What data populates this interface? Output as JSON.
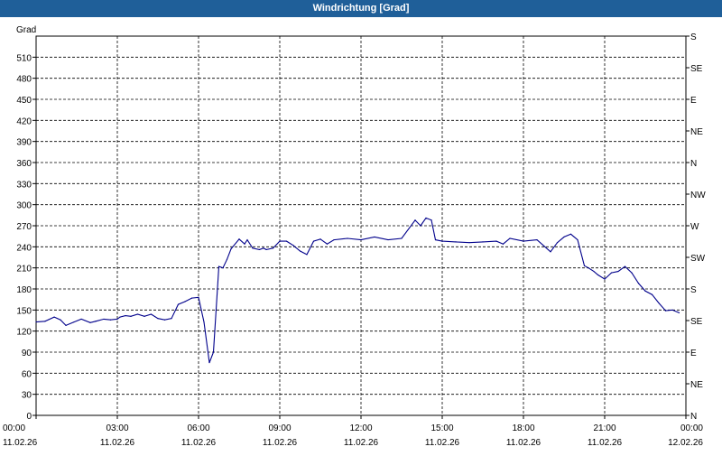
{
  "window": {
    "title": "Windrichtung [Grad]"
  },
  "chart_data": {
    "type": "line",
    "title": "Windrichtung [Grad]",
    "ylabel": "Grad",
    "ylim": [
      0,
      540
    ],
    "yticks": [
      0,
      30,
      60,
      90,
      120,
      150,
      180,
      210,
      240,
      270,
      300,
      330,
      360,
      390,
      420,
      450,
      480,
      510
    ],
    "right_axis_labels": [
      "N",
      "NE",
      "E",
      "SE",
      "S",
      "SW",
      "W",
      "NW",
      "N",
      "NE",
      "E",
      "SE",
      "S"
    ],
    "x_tick_hours": [
      0,
      3,
      6,
      9,
      12,
      15,
      18,
      21,
      24
    ],
    "x_tick_times": [
      "00:00",
      "03:00",
      "06:00",
      "09:00",
      "12:00",
      "15:00",
      "18:00",
      "21:00",
      "00:00"
    ],
    "x_tick_dates": [
      "11.02.26",
      "11.02.26",
      "11.02.26",
      "11.02.26",
      "11.02.26",
      "11.02.26",
      "11.02.26",
      "11.02.26",
      "12.02.26"
    ],
    "grid": true,
    "line_color": "#00008b",
    "series": [
      {
        "x_hours": [
          0,
          0.33,
          0.67,
          0.9,
          1.1,
          1.4,
          1.67,
          2.0,
          2.2,
          2.5,
          2.75,
          3.0,
          3.1,
          3.3,
          3.5,
          3.75,
          4.0,
          4.25,
          4.5,
          4.75,
          5.0,
          5.25,
          5.5,
          5.75,
          6.0,
          6.2,
          6.4,
          6.55,
          6.75,
          6.9,
          7.05,
          7.2,
          7.5,
          7.7,
          7.8,
          8.0,
          8.25,
          8.4,
          8.5,
          8.75,
          9.0,
          9.25,
          9.5,
          9.75,
          10.0,
          10.25,
          10.5,
          10.75,
          11.0,
          11.5,
          12.0,
          12.5,
          13.0,
          13.5,
          14.0,
          14.2,
          14.4,
          14.6,
          14.75,
          15.0,
          15.5,
          16.0,
          16.5,
          17.0,
          17.25,
          17.5,
          18.0,
          18.5,
          19.0,
          19.25,
          19.5,
          19.75,
          20.0,
          20.25,
          20.4,
          20.6,
          20.75,
          21.0,
          21.25,
          21.5,
          21.75,
          22.0,
          22.25,
          22.5,
          22.75,
          23.0,
          23.25,
          23.5,
          23.75
        ],
        "values": [
          133,
          134,
          140,
          136,
          128,
          133,
          137,
          132,
          134,
          137,
          136,
          137,
          140,
          142,
          141,
          144,
          141,
          144,
          138,
          136,
          138,
          158,
          162,
          167,
          168,
          133,
          75,
          90,
          212,
          210,
          222,
          237,
          251,
          244,
          250,
          238,
          236,
          238,
          236,
          238,
          248,
          248,
          242,
          234,
          229,
          248,
          251,
          244,
          250,
          252,
          250,
          254,
          250,
          252,
          278,
          270,
          281,
          278,
          250,
          248,
          247,
          246,
          247,
          248,
          244,
          252,
          248,
          250,
          233,
          246,
          254,
          258,
          250,
          213,
          210,
          205,
          200,
          194,
          203,
          205,
          212,
          203,
          188,
          177,
          172,
          160,
          149,
          150,
          146
        ]
      }
    ]
  }
}
